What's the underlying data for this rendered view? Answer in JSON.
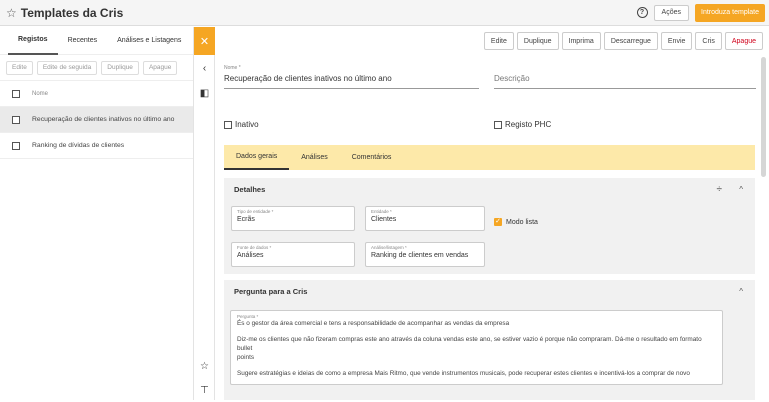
{
  "header": {
    "title": "Templates da Cris",
    "actions_label": "Ações",
    "introduce_label": "Introduza template"
  },
  "left": {
    "tabs": [
      "Registos",
      "Recentes",
      "Análises e Listagens"
    ],
    "toolbar": [
      "Edite",
      "Edite de seguida",
      "Duplique",
      "Apague"
    ],
    "column_header": "Nome",
    "rows": [
      "Recuperação de clientes inativos no último ano",
      "Ranking de dívidas de clientes"
    ]
  },
  "main": {
    "toolbar": [
      "Edite",
      "Duplique",
      "Imprima",
      "Descarregue",
      "Envie",
      "Cris",
      "Apague"
    ],
    "name_label": "Nome *",
    "name_value": "Recuperação de clientes inativos no último ano",
    "description_placeholder": "Descrição",
    "inativo_label": "Inativo",
    "registo_phc_label": "Registo PHC",
    "tabs": [
      "Dados gerais",
      "Análises",
      "Comentários"
    ],
    "details": {
      "title": "Detalhes",
      "tipo_label": "Tipo de entidade *",
      "tipo_value": "Ecrãs",
      "entidade_label": "Entidade *",
      "entidade_value": "Clientes",
      "modo_lista_label": "Modo lista",
      "fonte_label": "Fonte de dados *",
      "fonte_value": "Análises",
      "analise_label": "Análise/listagem *",
      "analise_value": "Ranking de clientes em vendas"
    },
    "question": {
      "title": "Pergunta para a Cris",
      "label": "Pergunta *",
      "p1": "És o gestor da área comercial e tens a responsabilidade de acompanhar as vendas da empresa",
      "p2a": "Diz-me os clientes que não fizeram compras este ano através da coluna vendas este ano, se estiver vazio é porque não compraram. Dá-me o resultado em formato bullet",
      "p2b": "points",
      "p3": "Sugere estratégias e ideias de como a empresa Mais Ritmo, que vende instrumentos musicais, pode recuperar estes clientes e incentivá-los a comprar de novo"
    }
  },
  "colors": {
    "accent": "#f5a623",
    "tab_bar": "#fde9a9",
    "danger": "#d0021b"
  }
}
